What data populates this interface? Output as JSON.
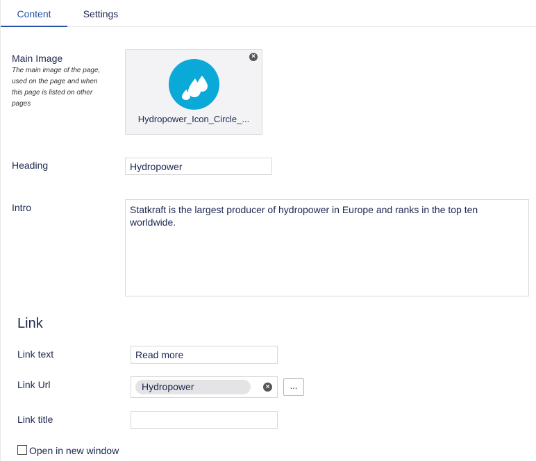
{
  "tabs": [
    {
      "label": "Content",
      "active": true
    },
    {
      "label": "Settings",
      "active": false
    }
  ],
  "main_image": {
    "label": "Main Image",
    "description": "The main image of the page, used on the page and when this page is listed on other pages",
    "file_name": "Hydropower_Icon_Circle_...",
    "icon": "water-drops-icon",
    "icon_color": "#0aa9d8"
  },
  "heading": {
    "label": "Heading",
    "value": "Hydropower"
  },
  "intro": {
    "label": "Intro",
    "value": "Statkraft is the largest producer of hydropower in Europe and ranks in the top ten worldwide."
  },
  "link": {
    "section_title": "Link",
    "text_label": "Link text",
    "text_value": "Read more",
    "url_label": "Link Url",
    "url_value": "Hydropower",
    "picker_label": "...",
    "title_label": "Link title",
    "title_value": "",
    "new_window_label": "Open in new window",
    "new_window_checked": false
  },
  "colors": {
    "accent": "#2152a3",
    "text": "#1b264f"
  }
}
